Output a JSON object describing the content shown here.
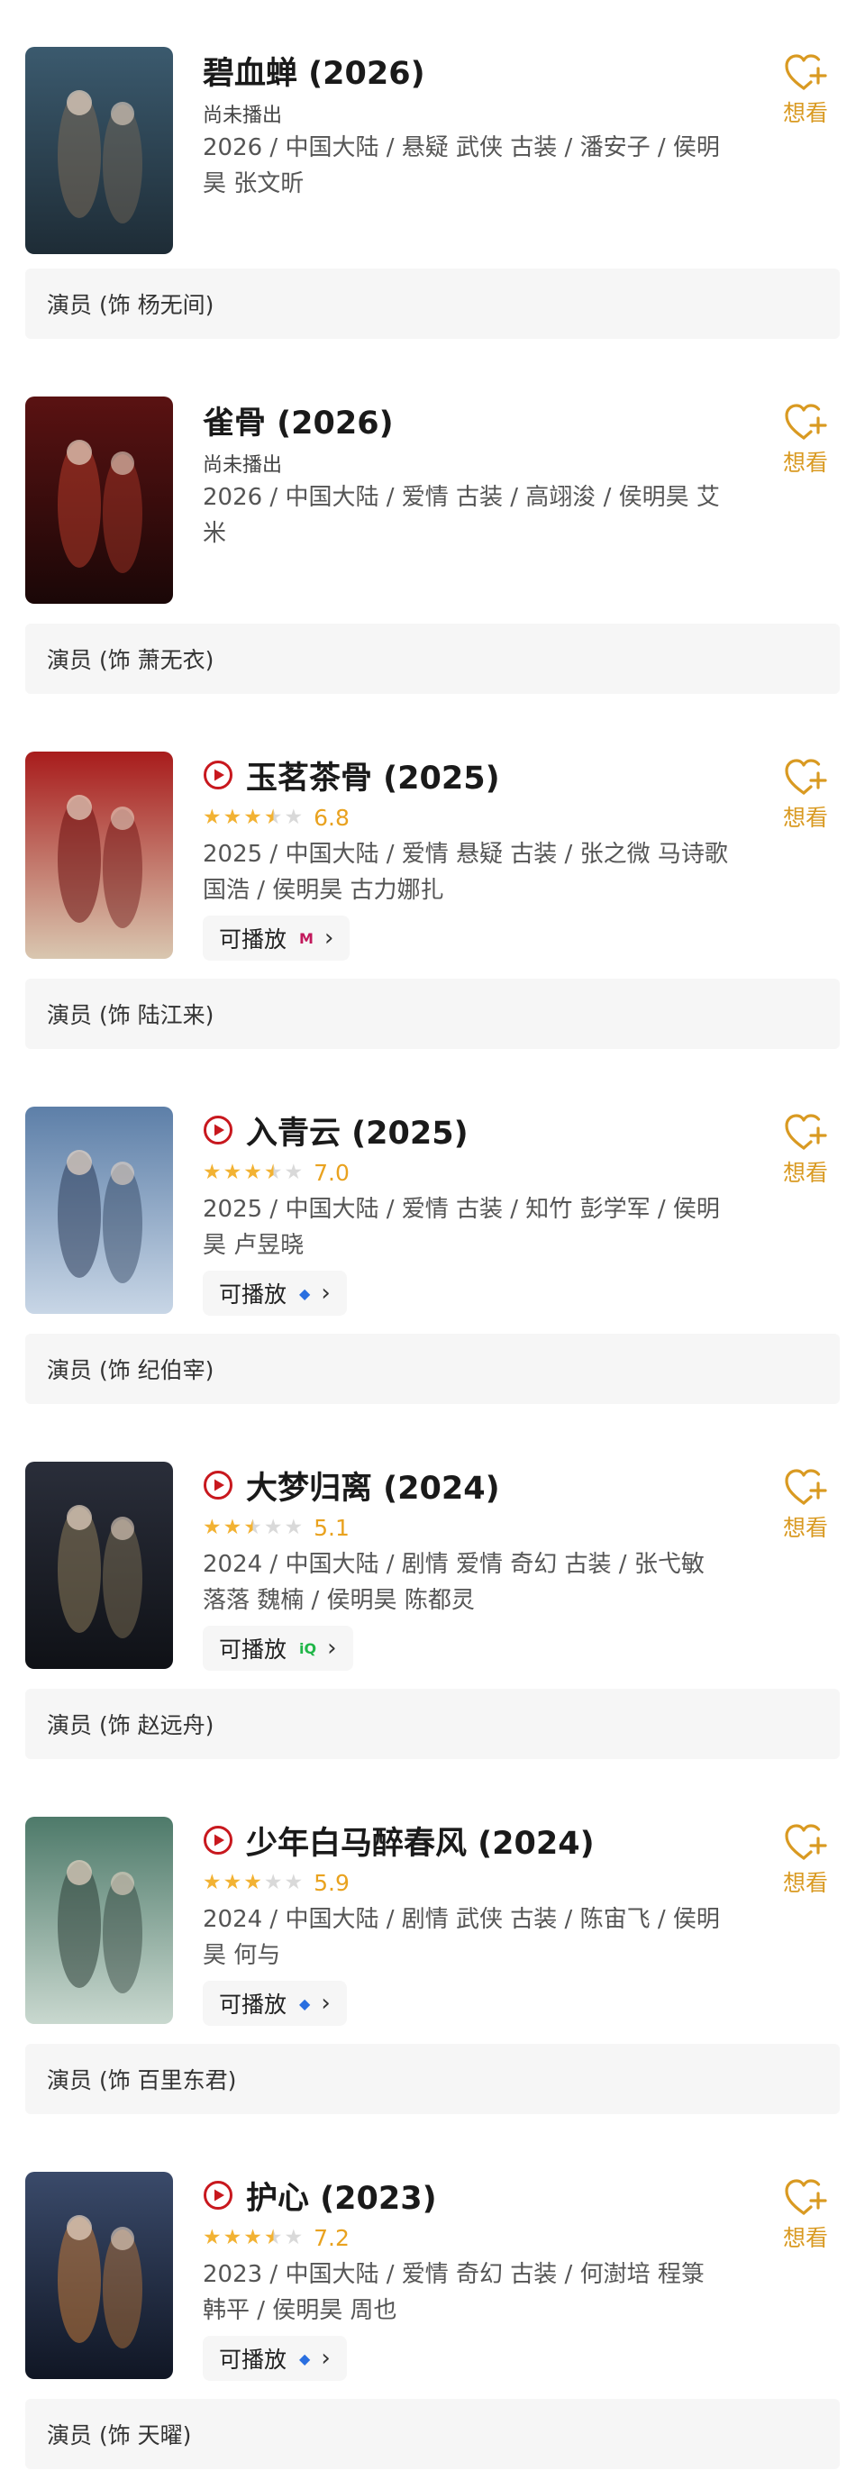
{
  "actions": {
    "want_label": "想看",
    "playable_label": "可播放"
  },
  "colors": {
    "accent": "#d99a22",
    "play_red": "#c8181e",
    "star": "#f2b233",
    "star_empty": "#d9d9d9"
  },
  "works": [
    {
      "title": "碧血蝉 (2026)",
      "status": "尚未播出",
      "meta": "2026 / 中国大陆 / 悬疑 武侠 古装 / 潘安子 / 侯明昊 张文昕",
      "role": "演员 (饰 杨无间)",
      "poster_colors": [
        "#3b5a6e",
        "#1e2c36",
        "#7a6a58"
      ]
    },
    {
      "title": "雀骨 (2026)",
      "status": "尚未播出",
      "meta": "2026 / 中国大陆 / 爱情 古装 / 高翊浚 / 侯明昊 艾米",
      "role": "演员 (饰 萧无衣)",
      "poster_colors": [
        "#5a1212",
        "#1a0707",
        "#b23a2a"
      ]
    },
    {
      "title": "玉茗茶骨 (2025)",
      "rating": {
        "stars": 3.5,
        "score": "6.8"
      },
      "meta": "2025 / 中国大陆 / 爱情 悬疑 古装 / 张之微 马诗歌 国浩 / 侯明昊 古力娜扎",
      "role": "演员 (饰 陆江来)",
      "platform_icon": "mango-logo",
      "platform_glyph": "M",
      "platform_color": "#c2185b",
      "poster_colors": [
        "#a81c1c",
        "#d9c7b0",
        "#6b1010"
      ]
    },
    {
      "title": "入青云 (2025)",
      "rating": {
        "stars": 3.5,
        "score": "7.0"
      },
      "meta": "2025 / 中国大陆 / 爱情 古装 / 知竹 彭学军 / 侯明昊 卢昱晓",
      "role": "演员 (饰 纪伯宰)",
      "platform_icon": "youku-logo",
      "platform_glyph": "◆",
      "platform_color": "#2a6fe0",
      "poster_colors": [
        "#5d7fa8",
        "#c8d6e6",
        "#2b3d5a"
      ]
    },
    {
      "title": "大梦归离 (2024)",
      "rating": {
        "stars": 2.5,
        "score": "5.1"
      },
      "meta": "2024 / 中国大陆 / 剧情 爱情 奇幻 古装 / 张弋敏 落落 魏楠 / 侯明昊 陈都灵",
      "role": "演员 (饰 赵远舟)",
      "platform_icon": "iqiyi-logo",
      "platform_glyph": "iQ",
      "platform_color": "#20b648",
      "poster_colors": [
        "#2a2e3a",
        "#0f1116",
        "#8a7a5a"
      ]
    },
    {
      "title": "少年白马醉春风 (2024)",
      "rating": {
        "stars": 3,
        "score": "5.9"
      },
      "meta": "2024 / 中国大陆 / 剧情 武侠 古装 / 陈宙飞 / 侯明昊 何与",
      "role": "演员 (饰 百里东君)",
      "platform_icon": "youku-logo",
      "platform_glyph": "◆",
      "platform_color": "#2a6fe0",
      "poster_colors": [
        "#4e7a6a",
        "#c9d8cf",
        "#2d3f38"
      ]
    },
    {
      "title": "护心 (2023)",
      "rating": {
        "stars": 3.5,
        "score": "7.2"
      },
      "meta": "2023 / 中国大陆 / 爱情 奇幻 古装 / 何澍培 程箓 韩平 / 侯明昊 周也",
      "role": "演员 (饰 天曜)",
      "platform_icon": "youku-logo",
      "platform_glyph": "◆",
      "platform_color": "#2a6fe0",
      "poster_colors": [
        "#3a4a6a",
        "#101624",
        "#c27a3a"
      ]
    }
  ]
}
